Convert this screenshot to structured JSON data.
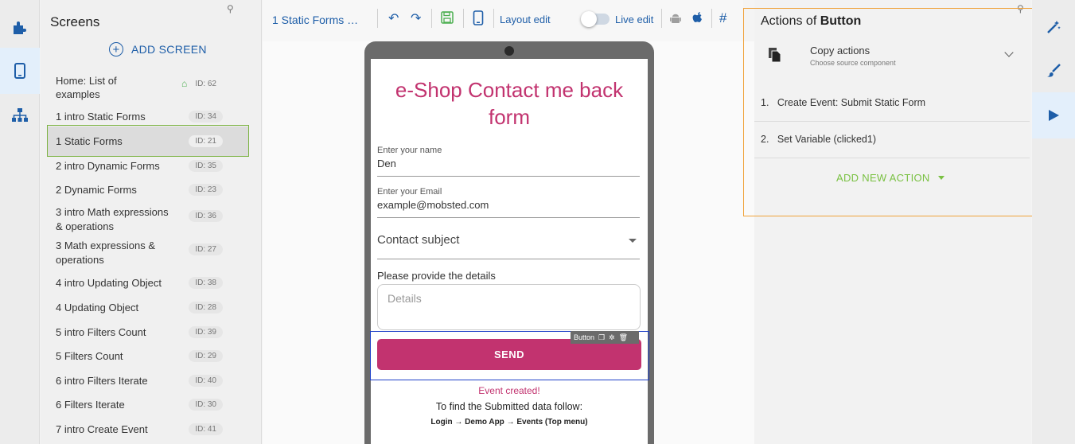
{
  "screens_panel": {
    "title": "Screens",
    "add_label": "ADD SCREEN",
    "items": [
      {
        "name": "Home: List of examples",
        "line1": "Home: List of",
        "line2": "examples",
        "id": "ID: 62"
      },
      {
        "name": "1 intro Static Forms",
        "id": "ID: 34"
      },
      {
        "name": "1 Static Forms",
        "id": "ID: 21"
      },
      {
        "name": "2 intro Dynamic Forms",
        "id": "ID: 35"
      },
      {
        "name": "2 Dynamic Forms",
        "id": "ID: 23"
      },
      {
        "name": "3 intro Math expressions & operations",
        "line1": "3 intro Math expressions",
        "line2": "& operations",
        "id": "ID: 36"
      },
      {
        "name": "3 Math expressions & operations",
        "line1": "3 Math expressions &",
        "line2": "operations",
        "id": "ID: 27"
      },
      {
        "name": "4 intro Updating Object",
        "id": "ID: 38"
      },
      {
        "name": "4 Updating Object",
        "id": "ID: 28"
      },
      {
        "name": "5 intro Filters Count",
        "id": "ID: 39"
      },
      {
        "name": "5 Filters Count",
        "id": "ID: 29"
      },
      {
        "name": "6 intro Filters Iterate",
        "id": "ID: 40"
      },
      {
        "name": "6 Filters Iterate",
        "id": "ID: 30"
      },
      {
        "name": "7 intro Create Event",
        "id": "ID: 41"
      }
    ]
  },
  "toolbar": {
    "screen_title": "1 Static Forms …",
    "layout_edit": "Layout edit",
    "live_edit": "Live edit",
    "hash": "#"
  },
  "phone": {
    "title_line1": "e-Shop Contact me back",
    "title_line2": "form",
    "name_label": "Enter your name",
    "name_value": "Den",
    "email_label": "Enter your Email",
    "email_value": "example@mobsted.com",
    "subject_label": "Contact subject",
    "details_label": "Please provide the details",
    "details_placeholder": "Details",
    "send_label": "SEND",
    "chip_label": "Button",
    "event_created": "Event created!",
    "find_text": "To find the Submitted data follow:",
    "path_text": "Login → Demo App → Events (Top menu)"
  },
  "actions_panel": {
    "title_prefix": "Actions of ",
    "title_bold": "Button",
    "copy_title": "Copy actions",
    "copy_subtitle": "Choose source component",
    "actions": [
      {
        "num": "1.",
        "label": "Create Event: Submit Static Form"
      },
      {
        "num": "2.",
        "label": "Set Variable (clicked1)"
      }
    ],
    "add_action_label": "ADD NEW ACTION"
  },
  "colors": {
    "accent_blue": "#1e5ea8",
    "brand_pink": "#c2336f",
    "green": "#7ac143",
    "orange_outline": "#f0a23a"
  }
}
